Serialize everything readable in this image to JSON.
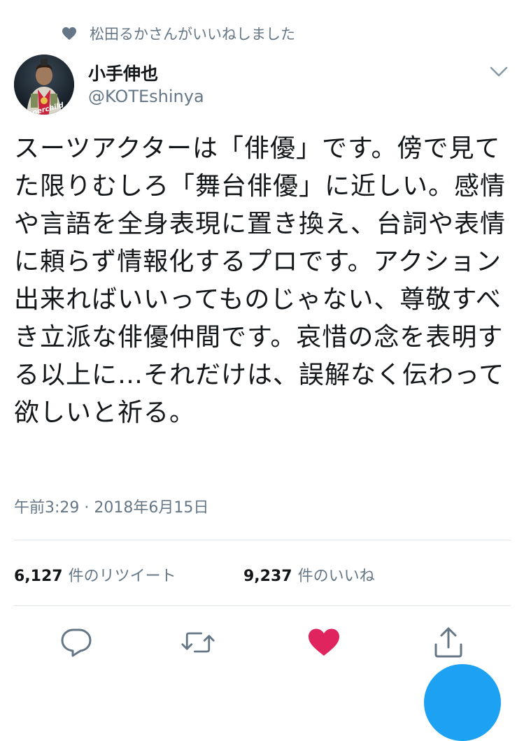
{
  "social_context": {
    "text": "松田るかさんがいいねしました",
    "icon": "heart-icon"
  },
  "author": {
    "display_name": "小手伸也",
    "handle": "@KOTEshinya",
    "avatar_text": "Innerchild"
  },
  "tweet": {
    "text": "スーツアクターは「俳優」です。傍で見てた限りむしろ「舞台俳優」に近しい。感情や言語を全身表現に置き換え、台詞や表情に頼らず情報化するプロです。アクション出来ればいいってものじゃない、尊敬すべき立派な俳優仲間です。哀惜の念を表明する以上に…それだけは、誤解なく伝わって欲しいと祈る。",
    "timestamp": "午前3:29 · 2018年6月15日"
  },
  "stats": {
    "retweets_count": "6,127",
    "retweets_label": "件のリツイート",
    "likes_count": "9,237",
    "likes_label": "件のいいね"
  },
  "actions": {
    "reply_icon": "reply-icon",
    "retweet_icon": "retweet-icon",
    "like_icon": "heart-icon",
    "like_color": "#e0245e",
    "share_icon": "share-icon"
  },
  "colors": {
    "accent": "#1da1f2",
    "muted": "#657786",
    "text": "#14171a",
    "like": "#e0245e"
  }
}
